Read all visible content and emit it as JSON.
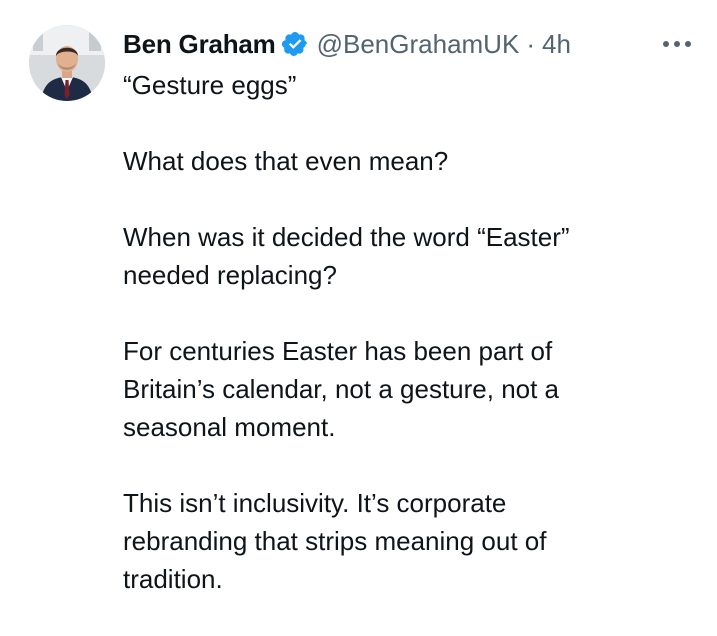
{
  "tweet": {
    "author": {
      "display_name": "Ben Graham",
      "verified_icon": "verified-badge-icon",
      "handle": "@BenGrahamUK",
      "separator": "·",
      "time": "4h",
      "avatar": "profile-photo"
    },
    "more_icon": "more-options-icon",
    "paragraphs": [
      "“Gesture eggs”",
      "What does that even mean?",
      "When was it decided the word “Easter”\nneeded replacing?",
      "For centuries Easter has been part of\nBritain’s calendar, not a gesture, not a\nseasonal moment.",
      "This isn’t inclusivity. It’s corporate\nrebranding that strips meaning out of\ntradition."
    ]
  },
  "colors": {
    "text": "#0f1419",
    "secondary": "#536471",
    "verified_blue": "#1d9bf0"
  }
}
